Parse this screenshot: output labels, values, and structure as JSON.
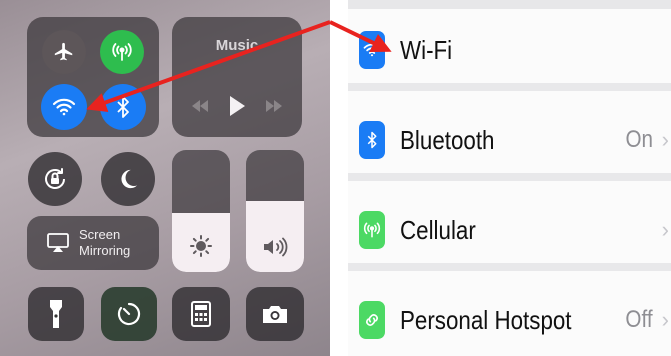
{
  "control_center": {
    "airplane_icon": "airplane-icon",
    "cellular_icon": "cellular-icon",
    "wifi_icon": "wifi-icon",
    "bluetooth_icon": "bluetooth-icon",
    "music_title": "Music",
    "screen_mirroring_line1": "Screen",
    "screen_mirroring_line2": "Mirroring",
    "brightness_level": 0.48,
    "volume_level": 0.58,
    "colors": {
      "active_blue": "#1a7cf5",
      "active_green": "#2ebd4e",
      "dark_tile": "#3a363a",
      "slider_fill": "#f5eef2"
    }
  },
  "settings": {
    "rows": [
      {
        "label": "Wi-Fi",
        "value": "",
        "icon": "wifi-icon",
        "color": "#1a7cf5"
      },
      {
        "label": "Bluetooth",
        "value": "On",
        "icon": "bluetooth-icon",
        "color": "#1a7cf5"
      },
      {
        "label": "Cellular",
        "value": "",
        "icon": "cellular-icon",
        "color": "#4cd964"
      },
      {
        "label": "Personal Hotspot",
        "value": "Off",
        "icon": "hotspot-icon",
        "color": "#4cd964"
      }
    ],
    "chevron": "›"
  },
  "annotation": {
    "arrow_color": "#e8231f"
  }
}
